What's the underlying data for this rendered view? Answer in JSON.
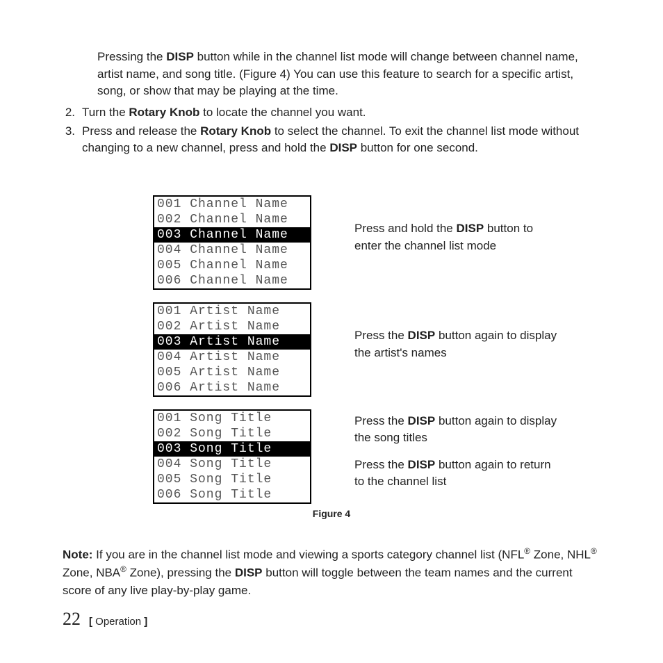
{
  "intro": "Pressing the DISP button while in the channel list mode will change between channel name, artist name, and song title. (Figure 4) You can use this feature to search for a specific artist, song, or show that may be playing at the time.",
  "intro_bold": [
    "DISP"
  ],
  "steps": [
    {
      "n": "2.",
      "pre": "Turn the ",
      "b1": "Rotary Knob",
      "mid": " to locate the channel you want.",
      "b2": "",
      "post": ""
    },
    {
      "n": "3.",
      "pre": "Press and release the ",
      "b1": "Rotary Knob",
      "mid": " to select the channel. To exit the channel list mode without changing to a new channel, press and hold the ",
      "b2": "DISP",
      "post": " button for one second."
    }
  ],
  "panels": [
    {
      "lines": [
        {
          "t": "001 Channel Name",
          "sel": false
        },
        {
          "t": "002 Channel Name",
          "sel": false
        },
        {
          "t": "003 Channel Name",
          "sel": true
        },
        {
          "t": "004 Channel Name",
          "sel": false
        },
        {
          "t": "005 Channel Name",
          "sel": false
        },
        {
          "t": "006 Channel Name",
          "sel": false
        }
      ],
      "captions": [
        {
          "pre": "Press and hold the ",
          "b": "DISP",
          "post": " button to enter the channel list mode"
        }
      ]
    },
    {
      "lines": [
        {
          "t": "001 Artist Name",
          "sel": false
        },
        {
          "t": "002 Artist Name",
          "sel": false
        },
        {
          "t": "003 Artist Name",
          "sel": true
        },
        {
          "t": "004 Artist Name",
          "sel": false
        },
        {
          "t": "005 Artist Name",
          "sel": false
        },
        {
          "t": "006 Artist Name",
          "sel": false
        }
      ],
      "captions": [
        {
          "pre": "Press the ",
          "b": "DISP",
          "post": " button again to display the artist's names"
        }
      ]
    },
    {
      "lines": [
        {
          "t": "001 Song Title",
          "sel": false
        },
        {
          "t": "002 Song Title",
          "sel": false
        },
        {
          "t": "003 Song Title",
          "sel": true
        },
        {
          "t": "004 Song Title",
          "sel": false
        },
        {
          "t": "005 Song Title",
          "sel": false
        },
        {
          "t": "006 Song Title",
          "sel": false
        }
      ],
      "captions": [
        {
          "pre": "Press the ",
          "b": "DISP",
          "post": " button again to display the song titles"
        },
        {
          "pre": "Press the ",
          "b": "DISP",
          "post": " button again to return to the channel list"
        }
      ]
    }
  ],
  "figure_label": "Figure 4",
  "note": {
    "label": "Note:",
    "pre": " If you are in the channel list mode and viewing a sports category channel list (NFL",
    "r1": "®",
    "mid1": " Zone, NHL",
    "r2": "®",
    "mid2": " Zone, NBA",
    "r3": "®",
    "mid3": " Zone), pressing the ",
    "b": "DISP",
    "post": " button will toggle between the team names and the current score of any live play-by-play game."
  },
  "footer": {
    "page": "22",
    "section": "Operation"
  }
}
